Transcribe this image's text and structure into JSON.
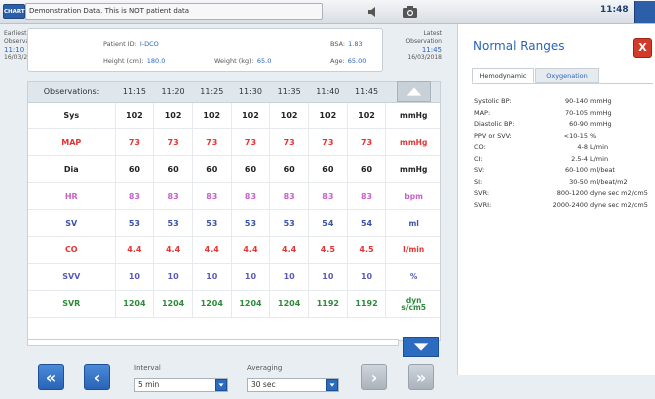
{
  "topbar": {
    "chart_label": "CHART",
    "banner": "Demonstration Data. This is NOT patient data",
    "time": "11:48"
  },
  "patient": {
    "earliest_label": "Earliest\nObservation",
    "earliest_time": "11:10",
    "earliest_date": "16/03/2018",
    "latest_label": "Latest\nObservation",
    "latest_time": "11:45",
    "latest_date": "16/03/2018",
    "id_label": "Patient ID:",
    "id_value": "I-DCO",
    "height_label": "Height (cm):",
    "height_value": "180.0",
    "weight_label": "Weight (kg):",
    "weight_value": "65.0",
    "bsa_label": "BSA:",
    "bsa_value": "1.83",
    "age_label": "Age:",
    "age_value": "65.00"
  },
  "table": {
    "header_label": "Observations:",
    "times": [
      "11:15",
      "11:20",
      "11:25",
      "11:30",
      "11:35",
      "11:40",
      "11:45"
    ],
    "rows": [
      {
        "name": "Sys",
        "unit": "mmHg",
        "color": "#222",
        "values": [
          "102",
          "102",
          "102",
          "102",
          "102",
          "102",
          "102"
        ]
      },
      {
        "name": "MAP",
        "unit": "mmHg",
        "color": "#e53333",
        "values": [
          "73",
          "73",
          "73",
          "73",
          "73",
          "73",
          "73"
        ]
      },
      {
        "name": "Dia",
        "unit": "mmHg",
        "color": "#222",
        "values": [
          "60",
          "60",
          "60",
          "60",
          "60",
          "60",
          "60"
        ]
      },
      {
        "name": "HR",
        "unit": "bpm",
        "color": "#c861c8",
        "values": [
          "83",
          "83",
          "83",
          "83",
          "83",
          "83",
          "83"
        ]
      },
      {
        "name": "SV",
        "unit": "ml",
        "color": "#3a52a8",
        "values": [
          "53",
          "53",
          "53",
          "53",
          "53",
          "54",
          "54"
        ]
      },
      {
        "name": "CO",
        "unit": "l/min",
        "color": "#e53333",
        "values": [
          "4.4",
          "4.4",
          "4.4",
          "4.4",
          "4.4",
          "4.5",
          "4.5"
        ]
      },
      {
        "name": "SVV",
        "unit": "%",
        "color": "#5a5ab8",
        "values": [
          "10",
          "10",
          "10",
          "10",
          "10",
          "10",
          "10"
        ]
      },
      {
        "name": "SVR",
        "unit": "dyn\ns/cm5",
        "color": "#2c8a3a",
        "values": [
          "1204",
          "1204",
          "1204",
          "1204",
          "1204",
          "1192",
          "1192"
        ]
      }
    ]
  },
  "controls": {
    "interval_label": "Interval",
    "interval_value": "5 min",
    "averaging_label": "Averaging",
    "averaging_value": "30 sec"
  },
  "ranges": {
    "title": "Normal Ranges",
    "close": "X",
    "tabs": [
      "Hemodynamic",
      "Oxygenation"
    ],
    "items": [
      {
        "name": "Systolic BP:",
        "range": "90-140",
        "unit": "mmHg"
      },
      {
        "name": "MAP:",
        "range": "70-105",
        "unit": "mmHg"
      },
      {
        "name": "Diastolic BP:",
        "range": "60-90",
        "unit": "mmHg"
      },
      {
        "name": "PPV or SVV:",
        "range": "<10-15",
        "unit": "%"
      },
      {
        "name": "CO:",
        "range": "4-8",
        "unit": "L/min"
      },
      {
        "name": "CI:",
        "range": "2.5-4",
        "unit": "L/min"
      },
      {
        "name": "SV:",
        "range": "60-100",
        "unit": "ml/beat"
      },
      {
        "name": "SI:",
        "range": "30-50",
        "unit": "ml/beat/m2"
      },
      {
        "name": "SVR:",
        "range": "800-1200",
        "unit": "dyne sec m2/cm5"
      },
      {
        "name": "SVRI:",
        "range": "2000-2400",
        "unit": "dyne sec m2/cm5"
      }
    ]
  }
}
